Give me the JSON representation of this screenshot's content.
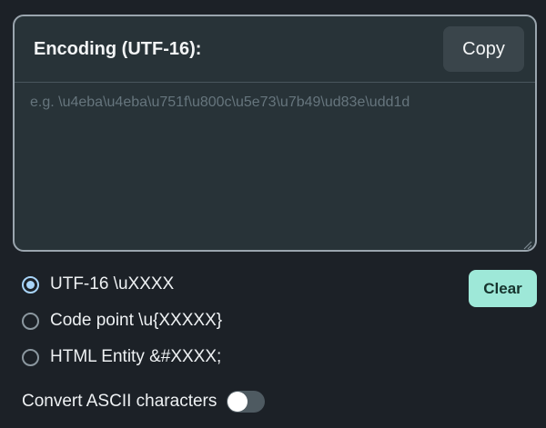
{
  "encoding_panel": {
    "title": "Encoding (UTF-16):",
    "copy_label": "Copy",
    "textarea_value": "",
    "textarea_placeholder": "e.g. \\u4eba\\u4eba\\u751f\\u800c\\u5e73\\u7b49\\ud83e\\udd1d"
  },
  "format_options": [
    {
      "label": "UTF-16 \\uXXXX",
      "selected": true
    },
    {
      "label": "Code point \\u{XXXXX}",
      "selected": false
    },
    {
      "label": "HTML Entity &#XXXX;",
      "selected": false
    }
  ],
  "clear_label": "Clear",
  "convert_ascii": {
    "label": "Convert ASCII characters",
    "enabled": false
  },
  "colors": {
    "background": "#1c2127",
    "panel": "#283338",
    "accent": "#a8d4f8",
    "clear_button": "#9ee8d8"
  },
  "icons": {
    "resize_handle": "resize-handle-icon"
  }
}
